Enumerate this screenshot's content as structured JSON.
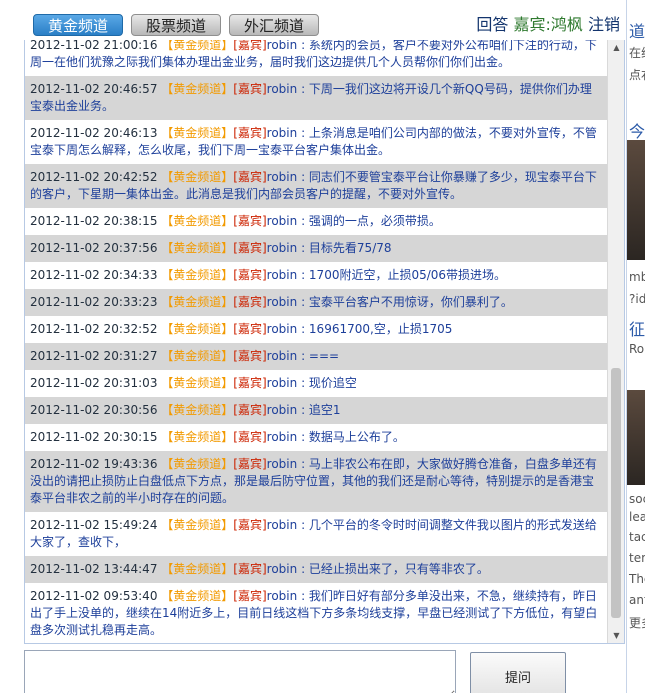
{
  "header": {
    "tabs": [
      {
        "label": "黄金频道",
        "active": true
      },
      {
        "label": "股票频道",
        "active": false
      },
      {
        "label": "外汇频道",
        "active": false
      }
    ],
    "right": {
      "answer_label": "回答",
      "guest_label": "嘉宾:",
      "guest_name": "鸿枫",
      "logout_label": "注销"
    }
  },
  "messages": [
    {
      "ts": "2012-11-02 21:00:16",
      "channel": "【黄金频道】",
      "guest": "[嘉宾]",
      "user": "robin",
      "sep": " : ",
      "text": "系统内的会员，客户不要对外公布咱们下注的行动，下周一在他们犹豫之际我们集体办理出金业务，届时我们这边提供几个人员帮你们你们出金。",
      "alt": false
    },
    {
      "ts": "2012-11-02 20:46:57",
      "channel": "【黄金频道】",
      "guest": "[嘉宾]",
      "user": "robin",
      "sep": " : ",
      "text": "下周一我们这边将开设几个新QQ号码，提供你们办理宝泰出金业务。",
      "alt": true
    },
    {
      "ts": "2012-11-02 20:46:13",
      "channel": "【黄金频道】",
      "guest": "[嘉宾]",
      "user": "robin",
      "sep": " : ",
      "text": "上条消息是咱们公司内部的做法，不要对外宣传，不管宝泰下周怎么解释，怎么收尾，我们下周一宝泰平台客户集体出金。",
      "alt": false
    },
    {
      "ts": "2012-11-02 20:42:52",
      "channel": "【黄金频道】",
      "guest": "[嘉宾]",
      "user": "robin",
      "sep": " : ",
      "text": "同志们不要管宝泰平台让你暴赚了多少，现宝泰平台下的客户，下星期一集体出金。此消息是我们内部会员客户的提醒，不要对外宣传。",
      "alt": true
    },
    {
      "ts": "2012-11-02 20:38:15",
      "channel": "【黄金频道】",
      "guest": "[嘉宾]",
      "user": "robin",
      "sep": " : ",
      "text": "强调的一点，必须带损。",
      "alt": false
    },
    {
      "ts": "2012-11-02 20:37:56",
      "channel": "【黄金频道】",
      "guest": "[嘉宾]",
      "user": "robin",
      "sep": " : ",
      "text": "目标先看75/78",
      "alt": true
    },
    {
      "ts": "2012-11-02 20:34:33",
      "channel": "【黄金频道】",
      "guest": "[嘉宾]",
      "user": "robin",
      "sep": " : ",
      "text": "1700附近空，止损05/06带损进场。",
      "alt": false
    },
    {
      "ts": "2012-11-02 20:33:23",
      "channel": "【黄金频道】",
      "guest": "[嘉宾]",
      "user": "robin",
      "sep": " : ",
      "text": "宝泰平台客户不用惊讶，你们暴利了。",
      "alt": true
    },
    {
      "ts": "2012-11-02 20:32:52",
      "channel": "【黄金频道】",
      "guest": "[嘉宾]",
      "user": "robin",
      "sep": " : ",
      "text": "16961700,空，止损1705",
      "alt": false
    },
    {
      "ts": "2012-11-02 20:31:27",
      "channel": "【黄金频道】",
      "guest": "[嘉宾]",
      "user": "robin",
      "sep": " : ",
      "text": "===",
      "alt": true
    },
    {
      "ts": "2012-11-02 20:31:03",
      "channel": "【黄金频道】",
      "guest": "[嘉宾]",
      "user": "robin",
      "sep": " : ",
      "text": "现价追空",
      "alt": false
    },
    {
      "ts": "2012-11-02 20:30:56",
      "channel": "【黄金频道】",
      "guest": "[嘉宾]",
      "user": "robin",
      "sep": " : ",
      "text": "追空1",
      "alt": true
    },
    {
      "ts": "2012-11-02 20:30:15",
      "channel": "【黄金频道】",
      "guest": "[嘉宾]",
      "user": "robin",
      "sep": " : ",
      "text": "数据马上公布了。",
      "alt": false
    },
    {
      "ts": "2012-11-02 19:43:36",
      "channel": "【黄金频道】",
      "guest": "[嘉宾]",
      "user": "robin",
      "sep": " : ",
      "text": "马上非农公布在即，大家做好腾仓准备，白盘多单还有没出的请把止损防止白盘低点下方点，那是最后防守位置，其他的我们还是耐心等待，特别提示的是香港宝泰平台非农之前的半小时存在的问题。",
      "alt": true
    },
    {
      "ts": "2012-11-02 15:49:24",
      "channel": "【黄金频道】",
      "guest": "[嘉宾]",
      "user": "robin",
      "sep": " : ",
      "text": "几个平台的冬令时时间调整文件我以图片的形式发送给大家了，查收下，",
      "alt": false
    },
    {
      "ts": "2012-11-02 13:44:47",
      "channel": "【黄金频道】",
      "guest": "[嘉宾]",
      "user": "robin",
      "sep": " : ",
      "text": "已经止损出来了，只有等非农了。",
      "alt": true
    },
    {
      "ts": "2012-11-02 09:53:40",
      "channel": "【黄金频道】",
      "guest": "[嘉宾]",
      "user": "robin",
      "sep": " : ",
      "text": "我们昨日好有部分多单没出来，不急，继续持有，昨日出了手上没单的，继续在14附近多上，目前日线这档下方多条均线支撑，早盘已经测试了下方低位，有望白盘多次测试扎稳再走高。",
      "alt": false
    }
  ],
  "input": {
    "placeholder": "",
    "submit_label": "提问"
  },
  "side": {
    "items": [
      "道",
      "在线",
      "点右",
      "今",
      "mb",
      "?id",
      "征",
      "Rol",
      "soc",
      "lea",
      "tac",
      "tem",
      "The",
      "ant",
      "更多"
    ]
  }
}
